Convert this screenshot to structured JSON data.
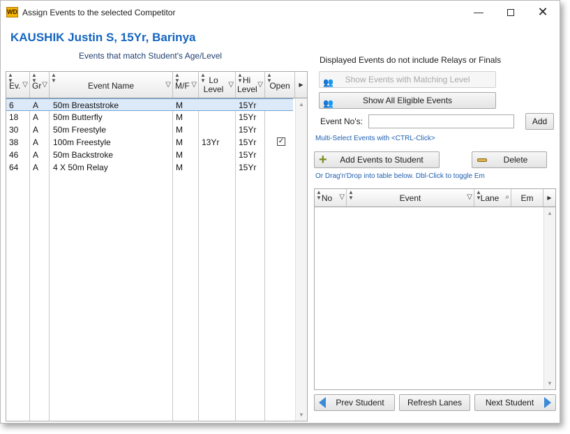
{
  "window": {
    "icon_text": "WD",
    "title": "Assign Events to the selected Competitor",
    "min_glyph": "—",
    "close_glyph": "✕"
  },
  "competitor": "KAUSHIK Justin S, 15Yr, Barinya",
  "subtitle": "Events that match Student's Age/Level",
  "events_grid": {
    "headers": {
      "ev": "Ev.",
      "gr": "Gr",
      "event_name": "Event Name",
      "mf": "M/F",
      "lo_level": "Lo Level",
      "hi_level": "Hi Level",
      "open": "Open"
    },
    "rows": [
      {
        "ev": "6",
        "gr": "A",
        "name": "50m Breaststroke",
        "mf": "M",
        "lo": "",
        "hi": "15Yr",
        "open": false,
        "selected": true
      },
      {
        "ev": "18",
        "gr": "A",
        "name": "50m Butterfly",
        "mf": "M",
        "lo": "",
        "hi": "15Yr",
        "open": false,
        "selected": false
      },
      {
        "ev": "30",
        "gr": "A",
        "name": "50m Freestyle",
        "mf": "M",
        "lo": "",
        "hi": "15Yr",
        "open": false,
        "selected": false
      },
      {
        "ev": "38",
        "gr": "A",
        "name": "100m Freestyle",
        "mf": "M",
        "lo": "13Yr",
        "hi": "15Yr",
        "open": true,
        "selected": false
      },
      {
        "ev": "46",
        "gr": "A",
        "name": "50m Backstroke",
        "mf": "M",
        "lo": "",
        "hi": "15Yr",
        "open": false,
        "selected": false
      },
      {
        "ev": "64",
        "gr": "A",
        "name": "4 X 50m Relay",
        "mf": "M",
        "lo": "",
        "hi": "15Yr",
        "open": false,
        "selected": false
      }
    ]
  },
  "right_panel": {
    "info": "Displayed Events do not include Relays or Finals",
    "show_matching_label": "Show Events with Matching Level",
    "show_all_label": "Show All Eligible Events",
    "event_nos_label": "Event No's:",
    "event_nos_value": "",
    "add_label": "Add",
    "multi_select_hint": "Multi-Select Events with <CTRL-Click>",
    "add_events_label": "Add Events to Student",
    "delete_label": "Delete",
    "drag_hint": "Or Drag'n'Drop into table below.  Dbl-Click to toggle Em"
  },
  "assigned_grid": {
    "headers": {
      "no": "No",
      "event": "Event",
      "lane": "Lane",
      "em": "Em"
    },
    "rows": []
  },
  "footer": {
    "prev_label": "Prev Student",
    "refresh_label": "Refresh Lanes",
    "next_label": "Next Student"
  },
  "colors": {
    "accent": "#1565c0",
    "selected_row": "#dbe9f8",
    "hint_text": "#1f5fb0"
  }
}
